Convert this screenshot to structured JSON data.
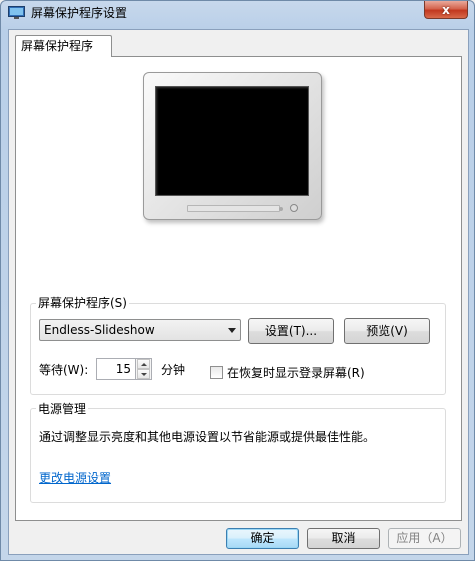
{
  "window": {
    "title": "屏幕保护程序设置",
    "close_label": "x"
  },
  "tab": {
    "label": "屏幕保护程序"
  },
  "screensaver": {
    "group_label": "屏幕保护程序(S)",
    "selected": "Endless-Slideshow",
    "settings_button": "设置(T)...",
    "preview_button": "预览(V)",
    "wait_label": "等待(W):",
    "wait_value": "15",
    "minutes_label": "分钟",
    "resume_checkbox_label": "在恢复时显示登录屏幕(R)",
    "resume_checked": false
  },
  "power": {
    "group_label": "电源管理",
    "description": "通过调整显示亮度和其他电源设置以节省能源或提供最佳性能。",
    "link": "更改电源设置"
  },
  "footer": {
    "ok": "确定",
    "cancel": "取消",
    "apply": "应用（A）"
  }
}
